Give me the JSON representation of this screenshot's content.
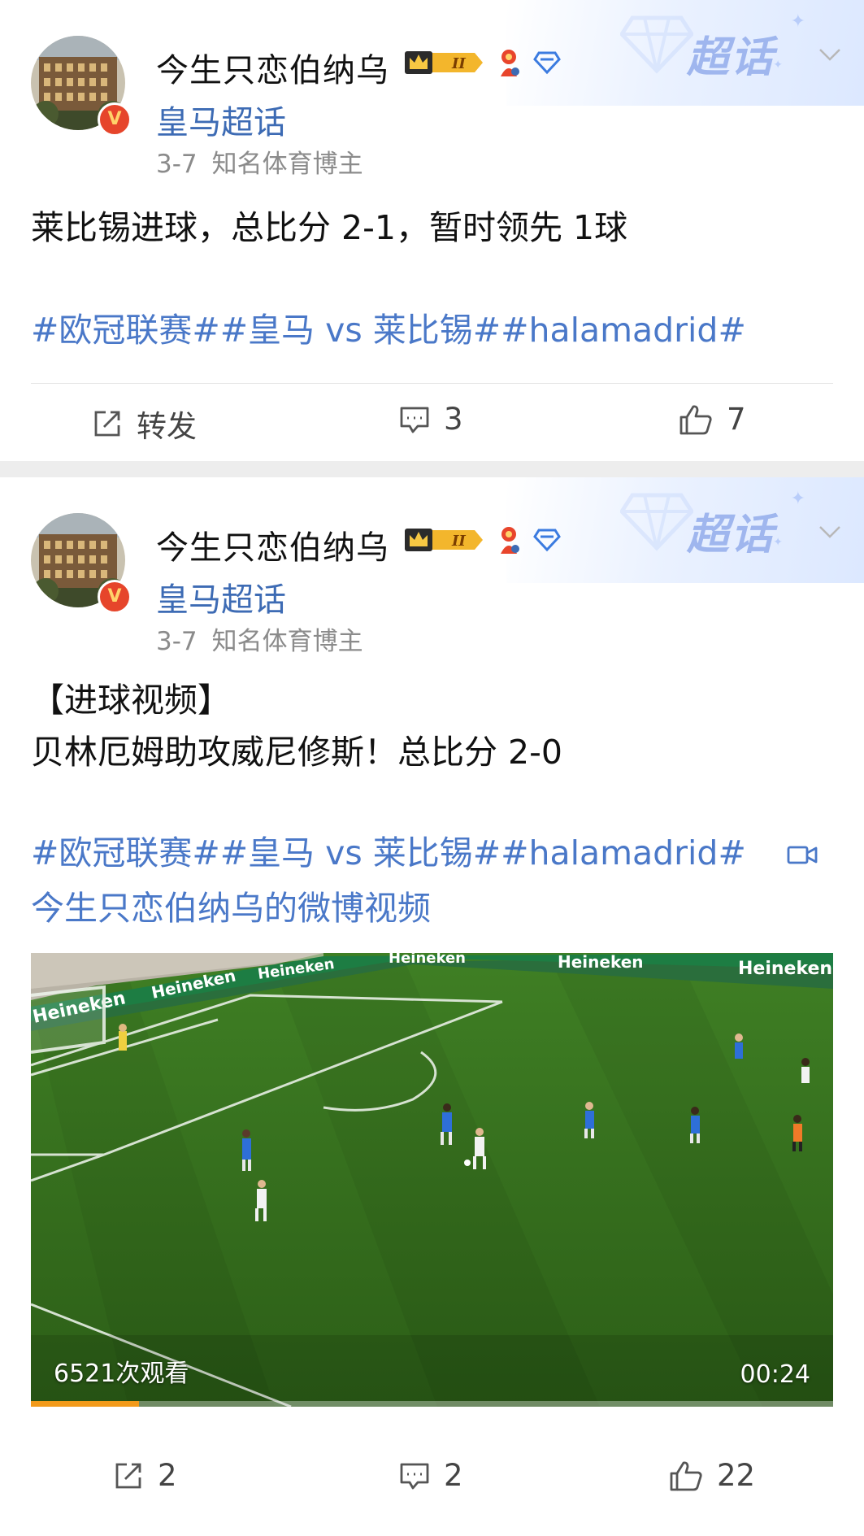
{
  "posts": [
    {
      "username": "今生只恋伯纳乌",
      "level_badge": "II",
      "supertopic": "皇马超话",
      "supertopic_brand": "超话",
      "date": "3-7",
      "role": "知名体育博主",
      "text_lines": [
        "莱比锡进球，总比分 2-1，暂时领先 1球"
      ],
      "hashtags": "#欧冠联赛##皇马 vs 莱比锡##halamadrid#",
      "actions": {
        "repost": "转发",
        "comments": "3",
        "likes": "7"
      }
    },
    {
      "username": "今生只恋伯纳乌",
      "level_badge": "II",
      "supertopic": "皇马超话",
      "supertopic_brand": "超话",
      "date": "3-7",
      "role": "知名体育博主",
      "text_lines": [
        "【进球视频】",
        "贝林厄姆助攻威尼修斯！总比分 2-0"
      ],
      "hashtags": "#欧冠联赛##皇马 vs 莱比锡##halamadrid#",
      "video_link": "今生只恋伯纳乌的微博视频",
      "video": {
        "views": "6521次观看",
        "duration": "00:24",
        "progress": 0.135,
        "pitch_sponsor": "Heineken"
      },
      "actions": {
        "repost": "2",
        "comments": "2",
        "likes": "22"
      }
    }
  ],
  "colors": {
    "link": "#4a78c8",
    "supertopic": "#3d6bb4",
    "progress": "#f29a1a",
    "vbadge": "#e6452b"
  }
}
